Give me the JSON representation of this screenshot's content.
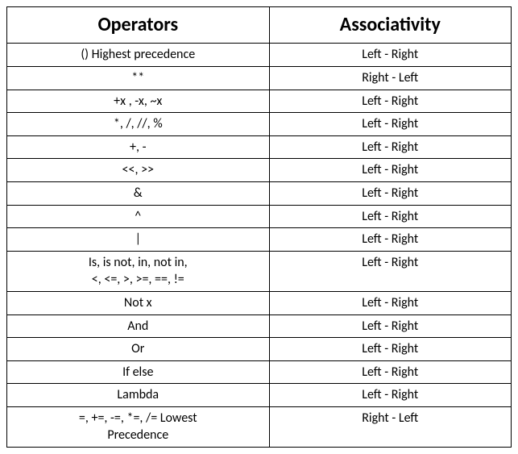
{
  "headers": {
    "operators": "Operators",
    "associativity": "Associativity"
  },
  "rows": [
    {
      "op": [
        "()  Highest precedence"
      ],
      "assoc": "Left - Right"
    },
    {
      "op": [
        "**"
      ],
      "assoc": "Right - Left"
    },
    {
      "op": [
        "+x , -x, ~x"
      ],
      "assoc": "Left - Right"
    },
    {
      "op": [
        "*, /, //, %"
      ],
      "assoc": "Left - Right"
    },
    {
      "op": [
        "+, -"
      ],
      "assoc": "Left - Right"
    },
    {
      "op": [
        "<<, >>"
      ],
      "assoc": "Left - Right"
    },
    {
      "op": [
        "&"
      ],
      "assoc": "Left - Right"
    },
    {
      "op": [
        "^"
      ],
      "assoc": "Left - Right"
    },
    {
      "op": [
        "|"
      ],
      "assoc": "Left - Right"
    },
    {
      "op": [
        "Is, is not, in, not in,",
        "<, <=, >, >=, ==, !="
      ],
      "assoc": "Left - Right"
    },
    {
      "op": [
        "Not x"
      ],
      "assoc": "Left - Right"
    },
    {
      "op": [
        "And"
      ],
      "assoc": "Left - Right"
    },
    {
      "op": [
        "Or"
      ],
      "assoc": "Left - Right"
    },
    {
      "op": [
        "If else"
      ],
      "assoc": "Left - Right"
    },
    {
      "op": [
        "Lambda"
      ],
      "assoc": "Left - Right"
    },
    {
      "op": [
        "=, +=, -=, *=, /=  Lowest",
        "Precedence"
      ],
      "assoc": "Right - Left"
    }
  ]
}
